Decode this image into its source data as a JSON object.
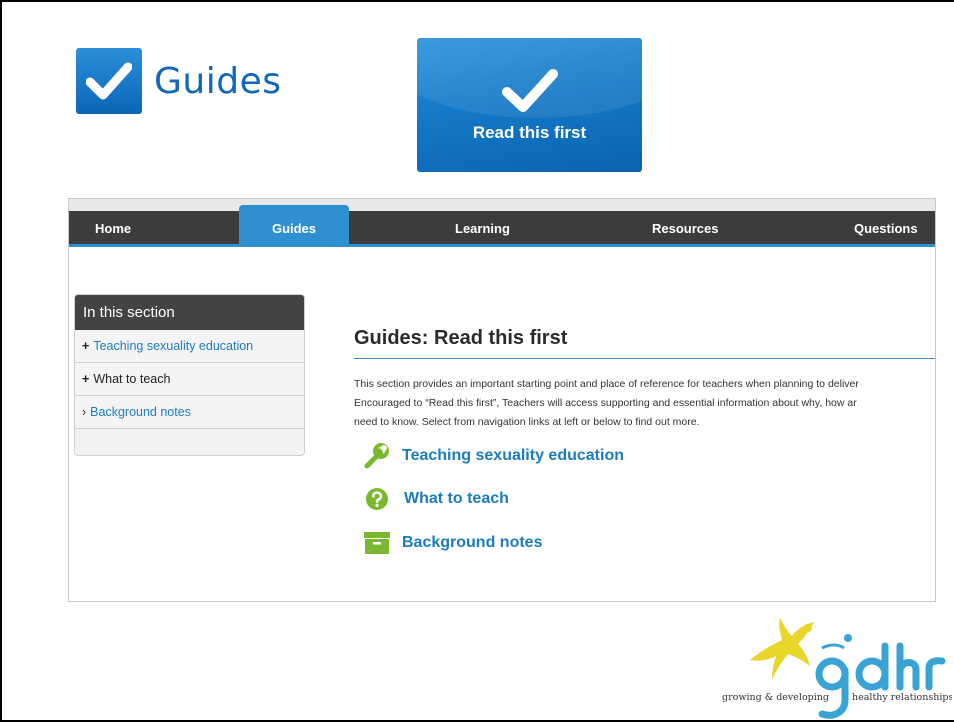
{
  "heading": {
    "title": "Guides"
  },
  "tile": {
    "label": "Read this first"
  },
  "site": {
    "nav": [
      {
        "label": "Home"
      },
      {
        "label": "Guides"
      },
      {
        "label": "Learning"
      },
      {
        "label": "Resources"
      },
      {
        "label": "Questions"
      }
    ],
    "sidebar": {
      "title": "In this section",
      "items": [
        {
          "marker": "+",
          "label": "Teaching sexuality education"
        },
        {
          "marker": "+",
          "label": "What to teach"
        },
        {
          "marker": "›",
          "label": "Background notes"
        }
      ]
    },
    "main": {
      "title": "Guides: Read this first",
      "intro": [
        "This section provides an important starting point and place of reference for teachers when planning to deliver",
        "Encouraged to “Read this first”, Teachers will access supporting and essential information about why, how ar",
        "need to know.  Select from navigation links at left or below to find out more."
      ],
      "links": [
        {
          "icon": "wrench-icon",
          "label": "Teaching sexuality education"
        },
        {
          "icon": "question-icon",
          "label": "What to teach"
        },
        {
          "icon": "archive-box-icon",
          "label": "Background notes"
        }
      ]
    }
  },
  "logo": {
    "wordmark": "gdhr",
    "tagline_left": "growing & developing",
    "tagline_right": "healthy relationships"
  },
  "colors": {
    "brand_blue": "#1167b8",
    "nav_dark": "#3c3c3c",
    "nav_active": "#2e90d0",
    "link_blue": "#1b7dbb",
    "icon_green": "#7cb82f",
    "logo_yellow": "#e8d62a",
    "logo_blue": "#3aa3d6"
  }
}
